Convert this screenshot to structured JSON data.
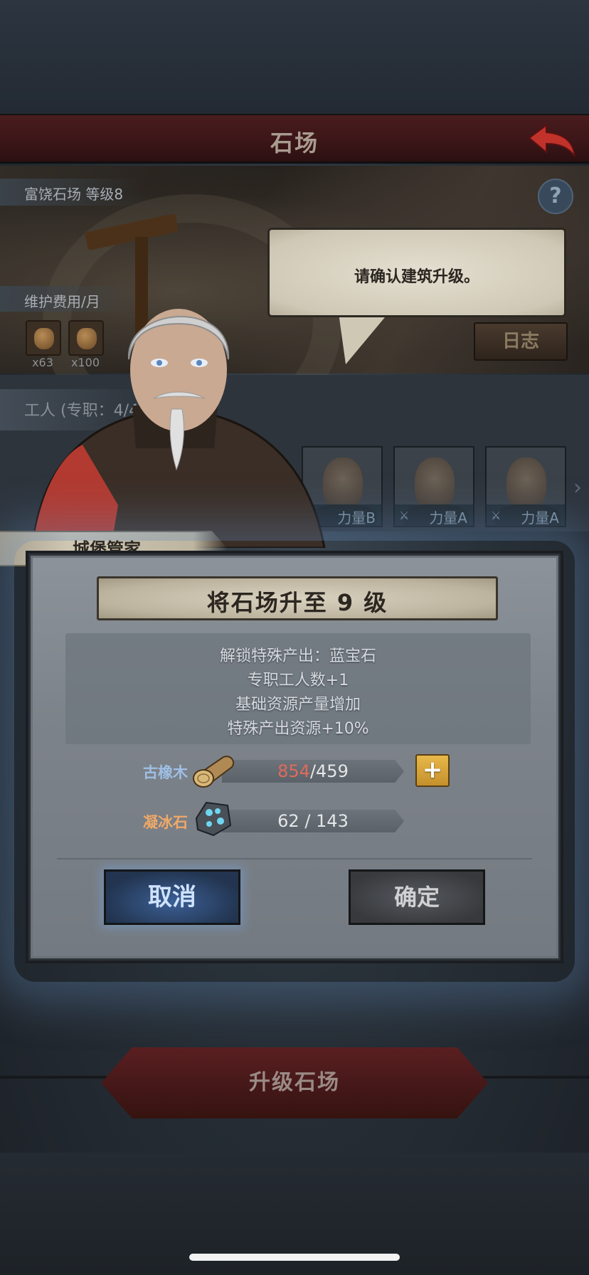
{
  "header": {
    "title": "石场"
  },
  "building": {
    "level_label": "富饶石场 等级8",
    "upkeep_label": "维护费用/月",
    "upkeep_items": [
      {
        "icon": "grain-sack-icon",
        "count": "x63"
      },
      {
        "icon": "grain-sack-icon",
        "count": "x100"
      }
    ],
    "log_button": "日志"
  },
  "speech": {
    "text": "请确认建筑升级。"
  },
  "workers": {
    "label": "工人 (专职：4/4",
    "cards": [
      {
        "tag": "力量B"
      },
      {
        "tag": "力量A"
      },
      {
        "tag": "力量A"
      }
    ]
  },
  "steward": {
    "name": "城堡管家"
  },
  "dialog": {
    "title": "将石场升至 9 级",
    "benefits": [
      "解锁特殊产出：蓝宝石",
      "专职工人数+1",
      "基础资源产量增加",
      "特殊产出资源+10%"
    ],
    "resources": [
      {
        "name": "古橡木",
        "have": "854",
        "need": "/459",
        "color": "#9fbfe6",
        "have_color": "#e06a5c"
      },
      {
        "name": "凝冰石",
        "have": "62",
        "need": " / 143",
        "color": "#f0a868",
        "have_color": "#e4e6e8"
      }
    ],
    "cancel_label": "取消",
    "confirm_label": "确定"
  },
  "bottom": {
    "upgrade_label": "升级石场"
  }
}
